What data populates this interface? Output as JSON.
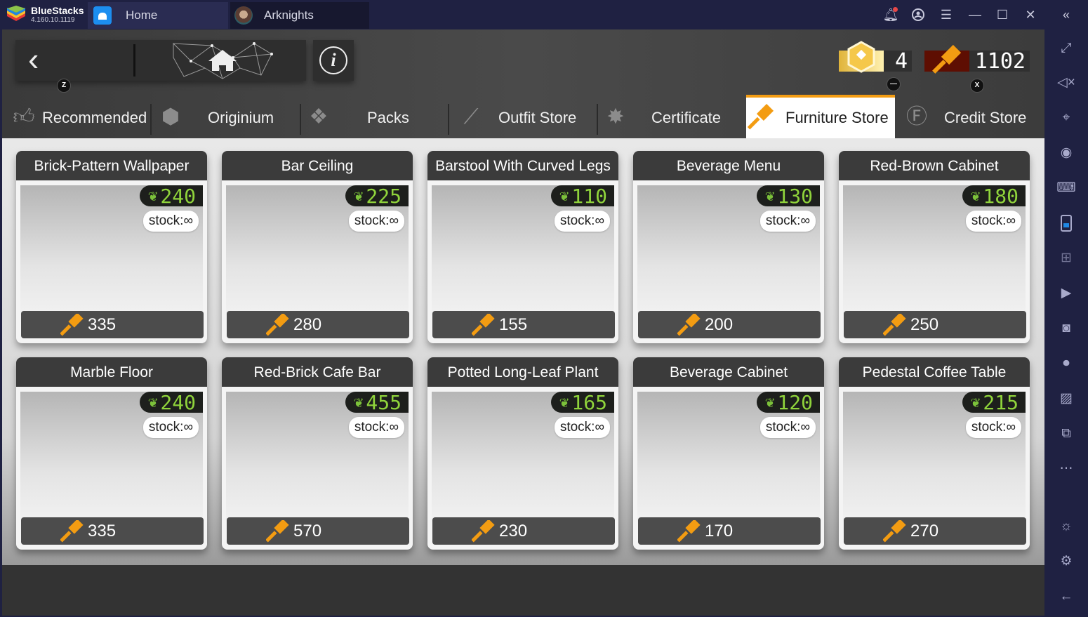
{
  "window": {
    "app_name": "BlueStacks",
    "app_version": "4.160.10.1119",
    "tabs": [
      {
        "label": "Home",
        "icon": "home-icon"
      },
      {
        "label": "Arknights",
        "icon": "arknights-avatar-icon"
      }
    ],
    "controls": [
      "bell-icon",
      "account-icon",
      "menu-icon",
      "minimize-icon",
      "maximize-icon",
      "close-icon",
      "collapse-sidebar-icon"
    ]
  },
  "sidebar": {
    "items": [
      {
        "name": "fullscreen",
        "glyph": "⤢"
      },
      {
        "name": "mute",
        "glyph": "🔇"
      },
      {
        "name": "pointer-lock",
        "glyph": "⌖"
      },
      {
        "name": "eye",
        "glyph": "◉"
      },
      {
        "name": "keyboard",
        "glyph": "⌨"
      },
      {
        "name": "phone-rotate",
        "glyph": "▯"
      },
      {
        "name": "gamepad",
        "glyph": "⊞"
      },
      {
        "name": "macro",
        "glyph": "▶"
      },
      {
        "name": "screenshot",
        "glyph": "◙"
      },
      {
        "name": "record",
        "glyph": "⏺"
      },
      {
        "name": "media-folder",
        "glyph": "🖼"
      },
      {
        "name": "multi-instance",
        "glyph": "⧉"
      },
      {
        "name": "more",
        "glyph": "⋯"
      },
      {
        "name": "tips",
        "glyph": "💡"
      },
      {
        "name": "settings",
        "glyph": "⚙"
      },
      {
        "name": "back",
        "glyph": "←"
      }
    ]
  },
  "game": {
    "key_hints": {
      "back": "Z",
      "resource_1": "—",
      "resource_2": "X"
    },
    "resources": {
      "certificate_count": "4",
      "furniture_parts": "1102"
    },
    "store_tabs": [
      {
        "label": "Recommended",
        "icon": "thumbs-up-icon",
        "active": false
      },
      {
        "label": "Originium",
        "icon": "originium-icon",
        "active": false
      },
      {
        "label": "Packs",
        "icon": "packs-icon",
        "active": false
      },
      {
        "label": "Outfit Store",
        "icon": "hanger-icon",
        "active": false
      },
      {
        "label": "Certificate",
        "icon": "certificate-icon",
        "active": false
      },
      {
        "label": "Furniture Store",
        "icon": "hammer-icon",
        "active": true
      },
      {
        "label": "Credit Store",
        "icon": "credit-icon",
        "active": false
      }
    ],
    "stock_label": "stock:∞",
    "items": [
      {
        "name": "Brick-Pattern Wallpaper",
        "comfort": "240",
        "price": "335"
      },
      {
        "name": "Bar Ceiling",
        "comfort": "225",
        "price": "280"
      },
      {
        "name": "Barstool With Curved Legs",
        "comfort": "110",
        "price": "155"
      },
      {
        "name": "Beverage Menu",
        "comfort": "130",
        "price": "200"
      },
      {
        "name": "Red-Brown Cabinet",
        "comfort": "180",
        "price": "250"
      },
      {
        "name": "Marble Floor",
        "comfort": "240",
        "price": "335"
      },
      {
        "name": "Red-Brick Cafe Bar",
        "comfort": "455",
        "price": "570"
      },
      {
        "name": "Potted Long-Leaf Plant",
        "comfort": "165",
        "price": "230"
      },
      {
        "name": "Beverage Cabinet",
        "comfort": "120",
        "price": "170"
      },
      {
        "name": "Pedestal Coffee Table",
        "comfort": "215",
        "price": "270"
      }
    ]
  },
  "colors": {
    "accent_orange": "#f39c12",
    "comfort_green": "#8fd33b",
    "chrome_bg": "#1f2142"
  }
}
